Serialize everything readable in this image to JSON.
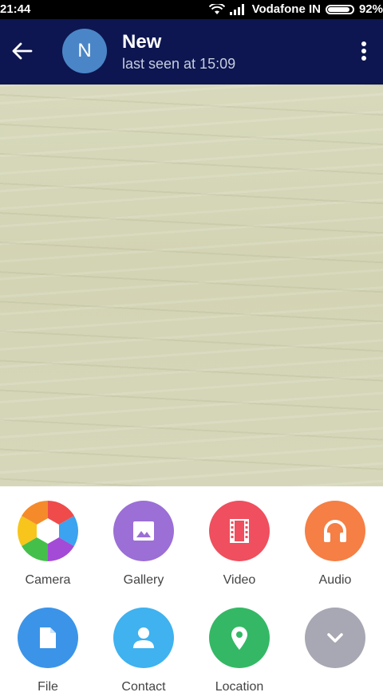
{
  "status_bar": {
    "time": "21:44",
    "carrier": "Vodafone IN",
    "battery_percent_text": "92%",
    "battery_level": 0.92
  },
  "header": {
    "avatar_letter": "N",
    "name": "New",
    "status": "last seen at 15:09",
    "bg_color": "#0d1650",
    "avatar_color": "#4a86c7"
  },
  "attach_menu": {
    "items": [
      {
        "label": "Camera",
        "icon": "camera-aperture-icon"
      },
      {
        "label": "Gallery",
        "icon": "image-icon",
        "color": "#9b6fd6"
      },
      {
        "label": "Video",
        "icon": "film-icon",
        "color": "#ef4f5e"
      },
      {
        "label": "Audio",
        "icon": "headphones-icon",
        "color": "#f57f45"
      },
      {
        "label": "File",
        "icon": "file-icon",
        "color": "#3b94e8"
      },
      {
        "label": "Contact",
        "icon": "person-icon",
        "color": "#3fb2ef"
      },
      {
        "label": "Location",
        "icon": "map-pin-icon",
        "color": "#34b865"
      },
      {
        "label": "",
        "icon": "chevron-down-icon",
        "color": "#a8a8b4"
      }
    ]
  }
}
